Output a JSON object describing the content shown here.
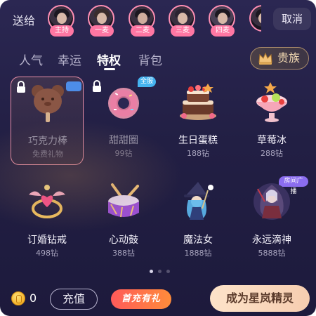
{
  "header": {
    "send_to_label": "送给",
    "cancel_label": "取消",
    "recipients": [
      {
        "tag": "主持"
      },
      {
        "tag": "一麦"
      },
      {
        "tag": "二麦"
      },
      {
        "tag": "三麦"
      },
      {
        "tag": "四麦"
      },
      {
        "tag": ""
      }
    ]
  },
  "tabs": [
    {
      "label": "人气",
      "active": false
    },
    {
      "label": "幸运",
      "active": false
    },
    {
      "label": "特权",
      "active": true
    },
    {
      "label": "背包",
      "active": false
    }
  ],
  "noble_button": {
    "label": "贵族",
    "icon": "crown-icon"
  },
  "gifts": [
    {
      "name": "巧克力棒",
      "price": "免费礼物",
      "locked": true,
      "selected": true,
      "badge": "",
      "icon": "chocolate-bear-bar-icon"
    },
    {
      "name": "甜甜圈",
      "price": "99钻",
      "locked": true,
      "selected": false,
      "badge": "全服",
      "icon": "donut-icon"
    },
    {
      "name": "生日蛋糕",
      "price": "188钻",
      "locked": false,
      "selected": false,
      "badge": "",
      "icon": "birthday-cake-icon"
    },
    {
      "name": "草莓冰",
      "price": "288钻",
      "locked": false,
      "selected": false,
      "badge": "",
      "icon": "strawberry-ice-icon"
    },
    {
      "name": "订婚钻戒",
      "price": "498钻",
      "locked": false,
      "selected": false,
      "badge": "",
      "icon": "engagement-ring-icon"
    },
    {
      "name": "心动鼓",
      "price": "388钻",
      "locked": false,
      "selected": false,
      "badge": "",
      "icon": "heart-drum-icon"
    },
    {
      "name": "魔法女",
      "price": "1888钻",
      "locked": false,
      "selected": false,
      "badge": "",
      "icon": "magic-girl-icon"
    },
    {
      "name": "永远滴神",
      "price": "5888钻",
      "locked": false,
      "selected": false,
      "badge": "房间广播",
      "icon": "eternal-god-icon"
    }
  ],
  "pager": {
    "pages": 3,
    "current": 1
  },
  "footer": {
    "balance": "0",
    "recharge_label": "充值",
    "first_charge_label": "首充有礼",
    "become_label": "成为星岚精灵"
  },
  "colors": {
    "panel_bg": "#221f44",
    "accent_pink": "#ff77a3",
    "selection_border": "#e98fa8",
    "badge_blue": "#45b3f0",
    "badge_purple": "#8b6df0",
    "cta_bg": "#fde3c9"
  }
}
